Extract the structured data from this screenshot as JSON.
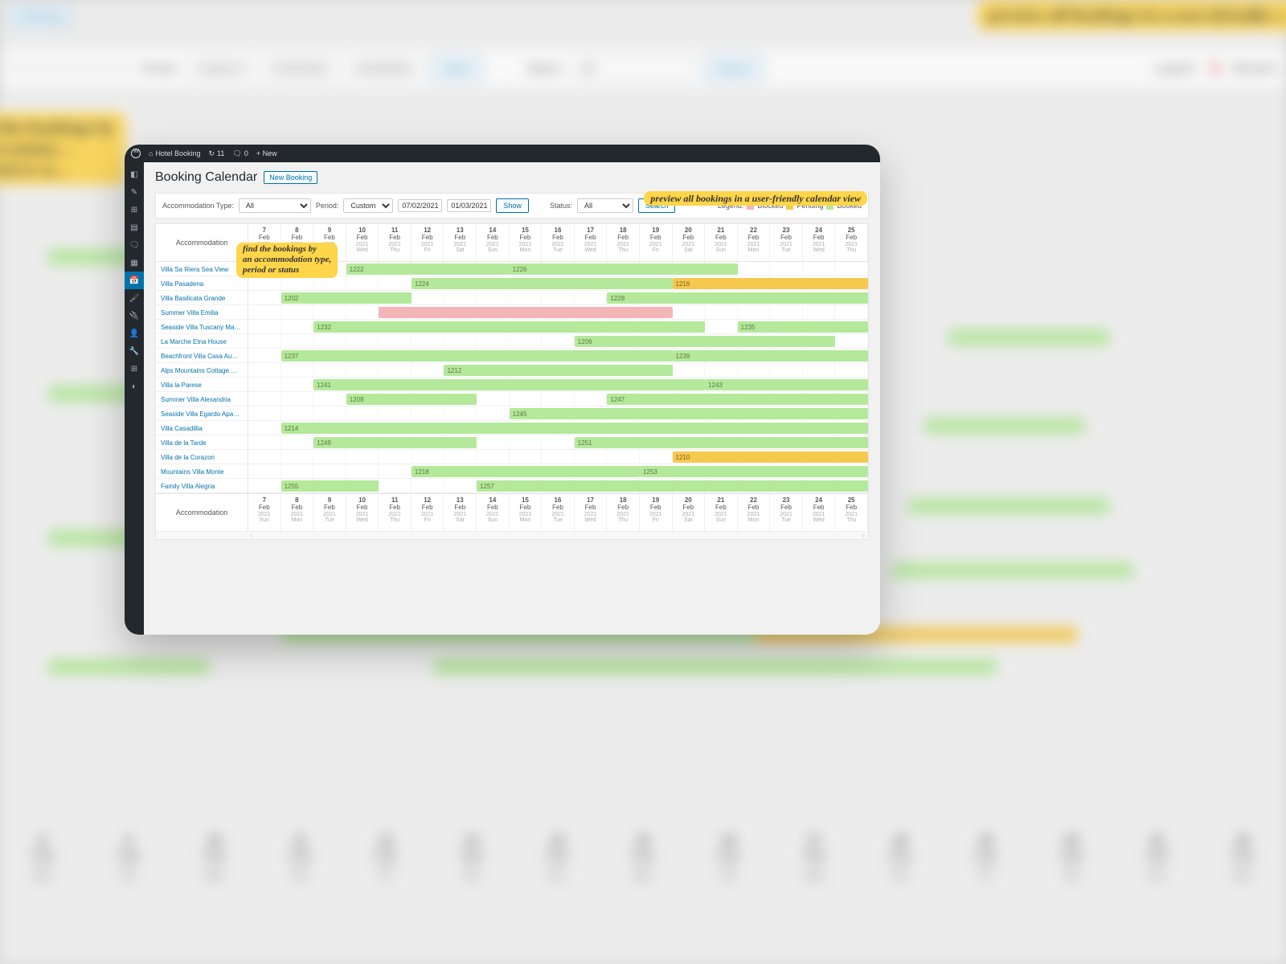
{
  "bg": {
    "new_booking": "w Booking",
    "annot_preview": "preview all bookings in a user-friendly c…",
    "annot_find": "d the bookings by\n accommo…\nriod or st…",
    "legend_label": "Legend:",
    "legend_blocked": "Blocked",
    "filter_period": "Period:",
    "filter_custom": "Custom ▾",
    "date1": "07/02/2021",
    "date2": "01/03/2021",
    "show": "Show",
    "status": "Status:",
    "all": "All",
    "search": "Search"
  },
  "adminbar": {
    "site": "Hotel Booking",
    "updates": "11",
    "comments": "0",
    "new": "+ New"
  },
  "page_title": "Booking Calendar",
  "new_booking_btn": "New Booking",
  "filter": {
    "acc_type_label": "Accommodation Type:",
    "acc_type_value": "All",
    "period_label": "Period:",
    "period_value": "Custom",
    "date_from": "07/02/2021",
    "date_to": "01/03/2021",
    "show": "Show",
    "status_label": "Status:",
    "status_value": "All",
    "search": "Search",
    "legend_label": "Legend:",
    "legend_blocked": "Blocked",
    "legend_pending": "Pending",
    "legend_booked": "Booked"
  },
  "annot_preview": "preview all bookings in a user-friendly calendar view",
  "annot_find_l1": "find the bookings by",
  "annot_find_l2": "an accommodation type,",
  "annot_find_l3": "period or status",
  "accommodation_header": "Accommodation",
  "dates": [
    {
      "d": "7",
      "m": "Feb",
      "y": "2021",
      "w": "Sun"
    },
    {
      "d": "8",
      "m": "Feb",
      "y": "2021",
      "w": "Mon"
    },
    {
      "d": "9",
      "m": "Feb",
      "y": "2021",
      "w": "Tue"
    },
    {
      "d": "10",
      "m": "Feb",
      "y": "2021",
      "w": "Wed"
    },
    {
      "d": "11",
      "m": "Feb",
      "y": "2021",
      "w": "Thu"
    },
    {
      "d": "12",
      "m": "Feb",
      "y": "2021",
      "w": "Fri"
    },
    {
      "d": "13",
      "m": "Feb",
      "y": "2021",
      "w": "Sat"
    },
    {
      "d": "14",
      "m": "Feb",
      "y": "2021",
      "w": "Sun"
    },
    {
      "d": "15",
      "m": "Feb",
      "y": "2021",
      "w": "Mon"
    },
    {
      "d": "16",
      "m": "Feb",
      "y": "2021",
      "w": "Tue"
    },
    {
      "d": "17",
      "m": "Feb",
      "y": "2021",
      "w": "Wed"
    },
    {
      "d": "18",
      "m": "Feb",
      "y": "2021",
      "w": "Thu"
    },
    {
      "d": "19",
      "m": "Feb",
      "y": "2021",
      "w": "Fri"
    },
    {
      "d": "20",
      "m": "Feb",
      "y": "2021",
      "w": "Sat"
    },
    {
      "d": "21",
      "m": "Feb",
      "y": "2021",
      "w": "Sun"
    },
    {
      "d": "22",
      "m": "Feb",
      "y": "2021",
      "w": "Mon"
    },
    {
      "d": "23",
      "m": "Feb",
      "y": "2021",
      "w": "Tue"
    },
    {
      "d": "24",
      "m": "Feb",
      "y": "2021",
      "w": "Wed"
    },
    {
      "d": "25",
      "m": "Feb",
      "y": "2021",
      "w": "Thu"
    }
  ],
  "rows": [
    {
      "name": "Villa Sa Riera Sea View",
      "bookings": [
        {
          "id": "1222",
          "start": 3,
          "end": 8,
          "status": "booked"
        },
        {
          "id": "1226",
          "start": 8,
          "end": 15,
          "status": "booked"
        }
      ]
    },
    {
      "name": "Villa Pasadena",
      "bookings": [
        {
          "id": "1224",
          "start": 5,
          "end": 13,
          "status": "booked"
        },
        {
          "id": "1216",
          "start": 13,
          "end": 19,
          "status": "pending"
        }
      ]
    },
    {
      "name": "Villa Basilicata Grande",
      "bookings": [
        {
          "id": "1202",
          "start": 1,
          "end": 5,
          "status": "booked"
        },
        {
          "id": "1228",
          "start": 11,
          "end": 19,
          "status": "booked"
        }
      ]
    },
    {
      "name": "Summer Villa Emilia",
      "bookings": [
        {
          "id": "",
          "start": 4,
          "end": 13,
          "status": "blocked"
        }
      ]
    },
    {
      "name": "Seaside Villa Tuscany Ma…",
      "bookings": [
        {
          "id": "1232",
          "start": 2,
          "end": 14,
          "status": "booked"
        },
        {
          "id": "1235",
          "start": 15,
          "end": 19,
          "status": "booked"
        }
      ]
    },
    {
      "name": "La Marche Etna House",
      "bookings": [
        {
          "id": "1206",
          "start": 10,
          "end": 18,
          "status": "booked"
        }
      ]
    },
    {
      "name": "Beachfront Villa Casa Au…",
      "bookings": [
        {
          "id": "1237",
          "start": 1,
          "end": 13,
          "status": "booked"
        },
        {
          "id": "1239",
          "start": 13,
          "end": 19,
          "status": "booked"
        }
      ]
    },
    {
      "name": "Alps Mountains Cottage …",
      "bookings": [
        {
          "id": "1212",
          "start": 6,
          "end": 13,
          "status": "booked"
        }
      ]
    },
    {
      "name": "Villa la Parese",
      "bookings": [
        {
          "id": "1241",
          "start": 2,
          "end": 14,
          "status": "booked"
        },
        {
          "id": "1243",
          "start": 14,
          "end": 19,
          "status": "booked"
        }
      ]
    },
    {
      "name": "Summer Villa Alexandria",
      "bookings": [
        {
          "id": "1208",
          "start": 3,
          "end": 7,
          "status": "booked"
        },
        {
          "id": "1247",
          "start": 11,
          "end": 19,
          "status": "booked"
        }
      ]
    },
    {
      "name": "Seaside Villa Egardo Apa…",
      "bookings": [
        {
          "id": "1245",
          "start": 8,
          "end": 19,
          "status": "booked"
        }
      ]
    },
    {
      "name": "Villa Casadillia",
      "bookings": [
        {
          "id": "1214",
          "start": 1,
          "end": 19,
          "status": "booked"
        }
      ]
    },
    {
      "name": "Villa de la Tarde",
      "bookings": [
        {
          "id": "1249",
          "start": 2,
          "end": 7,
          "status": "booked"
        },
        {
          "id": "1251",
          "start": 10,
          "end": 19,
          "status": "booked"
        }
      ]
    },
    {
      "name": "Villa de la Corazon",
      "bookings": [
        {
          "id": "1210",
          "start": 13,
          "end": 19,
          "status": "pending"
        }
      ]
    },
    {
      "name": "Mountains Villa Monte",
      "bookings": [
        {
          "id": "1218",
          "start": 5,
          "end": 12,
          "status": "booked"
        },
        {
          "id": "1253",
          "start": 12,
          "end": 19,
          "status": "booked"
        }
      ]
    },
    {
      "name": "Family Villa Alegria",
      "bookings": [
        {
          "id": "1255",
          "start": 1,
          "end": 4,
          "status": "booked"
        },
        {
          "id": "1257",
          "start": 7,
          "end": 19,
          "status": "booked"
        }
      ]
    }
  ]
}
